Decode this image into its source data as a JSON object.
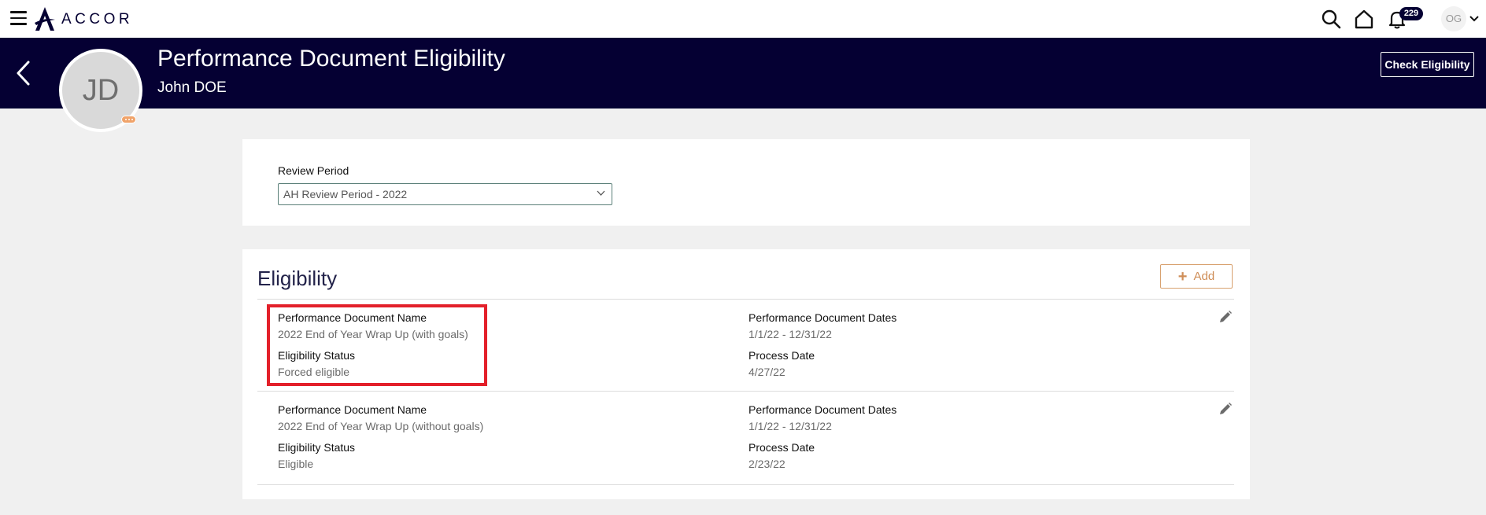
{
  "app": {
    "brand": "ACCOR",
    "notifications_count": "229",
    "user_initials": "OG"
  },
  "header": {
    "title": "Performance Document Eligibility",
    "subtitle": "John DOE",
    "avatar_initials": "JD",
    "check_button": "Check Eligibility"
  },
  "review": {
    "label": "Review Period",
    "selected": "AH Review Period - 2022"
  },
  "eligibility": {
    "title": "Eligibility",
    "add_label": "Add",
    "rows": [
      {
        "name_label": "Performance Document Name",
        "name_value": "2022 End of Year Wrap Up (with goals)",
        "status_label": "Eligibility Status",
        "status_value": "Forced eligible",
        "dates_label": "Performance Document Dates",
        "dates_value": "1/1/22 - 12/31/22",
        "process_label": "Process Date",
        "process_value": "4/27/22"
      },
      {
        "name_label": "Performance Document Name",
        "name_value": "2022 End of Year Wrap Up (without goals)",
        "status_label": "Eligibility Status",
        "status_value": "Eligible",
        "dates_label": "Performance Document Dates",
        "dates_value": "1/1/22 - 12/31/22",
        "process_label": "Process Date",
        "process_value": "2/23/22"
      }
    ]
  },
  "colors": {
    "header_bg": "#050033",
    "accent_orange": "#cf8e58",
    "highlight_red": "#e3202a"
  },
  "icons": [
    "menu-icon",
    "accor-logo",
    "search-icon",
    "home-icon",
    "bell-icon",
    "chevron-down-icon",
    "back-arrow-icon",
    "edit-pencil-icon",
    "plus-icon"
  ]
}
